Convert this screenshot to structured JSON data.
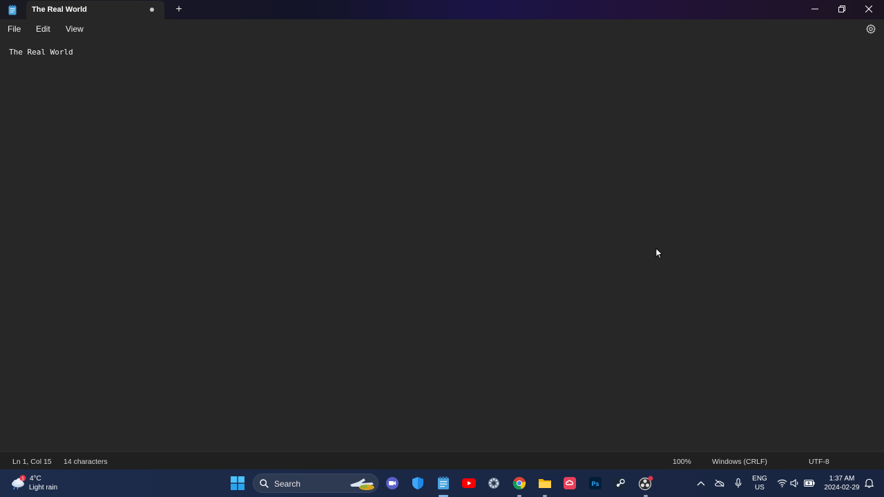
{
  "window": {
    "tab_title": "The Real World",
    "new_tab_label": "+"
  },
  "menu": {
    "file": "File",
    "edit": "Edit",
    "view": "View"
  },
  "editor": {
    "content": "The Real World"
  },
  "status": {
    "position": "Ln 1, Col 15",
    "char_count": "14 characters",
    "zoom": "100%",
    "line_ending": "Windows (CRLF)",
    "encoding": "UTF-8"
  },
  "taskbar": {
    "weather_temp": "4°C",
    "weather_desc": "Light rain",
    "weather_badge": "1",
    "search_label": "Search",
    "language_top": "ENG",
    "language_bottom": "US",
    "time": "1:37 AM",
    "date": "2024-02-29"
  },
  "colors": {
    "accent": "#7fb6e8",
    "editor_bg": "#272727",
    "statusbar_bg": "#202020",
    "taskbar_bg": "#1a2846"
  }
}
